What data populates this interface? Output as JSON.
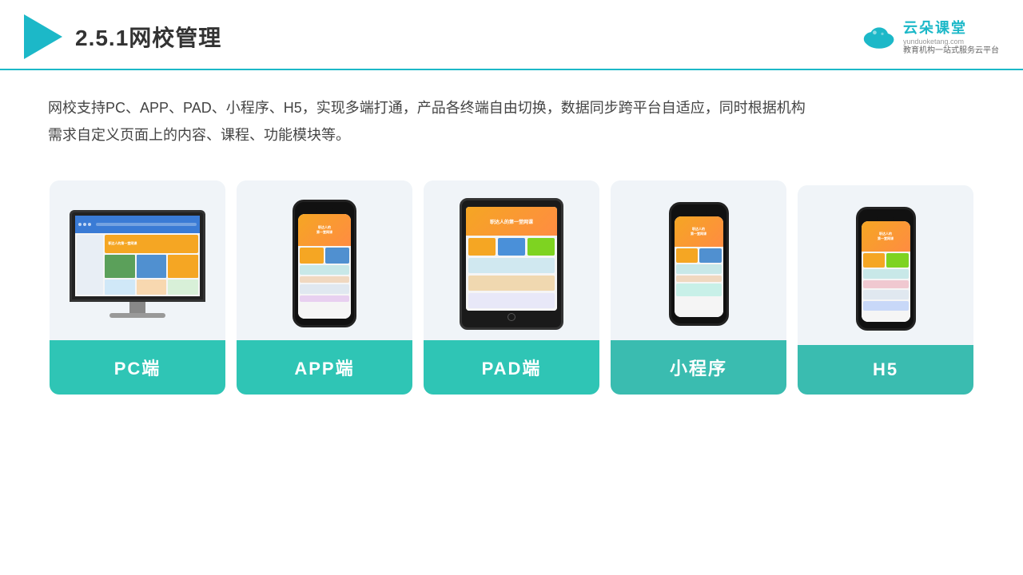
{
  "header": {
    "title": "2.5.1网校管理",
    "brand": {
      "name": "云朵课堂",
      "url": "yunduoketang.com",
      "subtitle": "教育机构一站\n式服务云平台"
    }
  },
  "description": "网校支持PC、APP、PAD、小程序、H5，实现多端打通，产品各终端自由切换，数据同步跨平台自适应，同时根据机构\n需求自定义页面上的内容、课程、功能模块等。",
  "cards": [
    {
      "id": "pc",
      "label": "PC端",
      "device": "pc"
    },
    {
      "id": "app",
      "label": "APP端",
      "device": "phone"
    },
    {
      "id": "pad",
      "label": "PAD端",
      "device": "tablet"
    },
    {
      "id": "miniapp",
      "label": "小程序",
      "device": "phone"
    },
    {
      "id": "h5",
      "label": "H5",
      "device": "phone"
    }
  ]
}
